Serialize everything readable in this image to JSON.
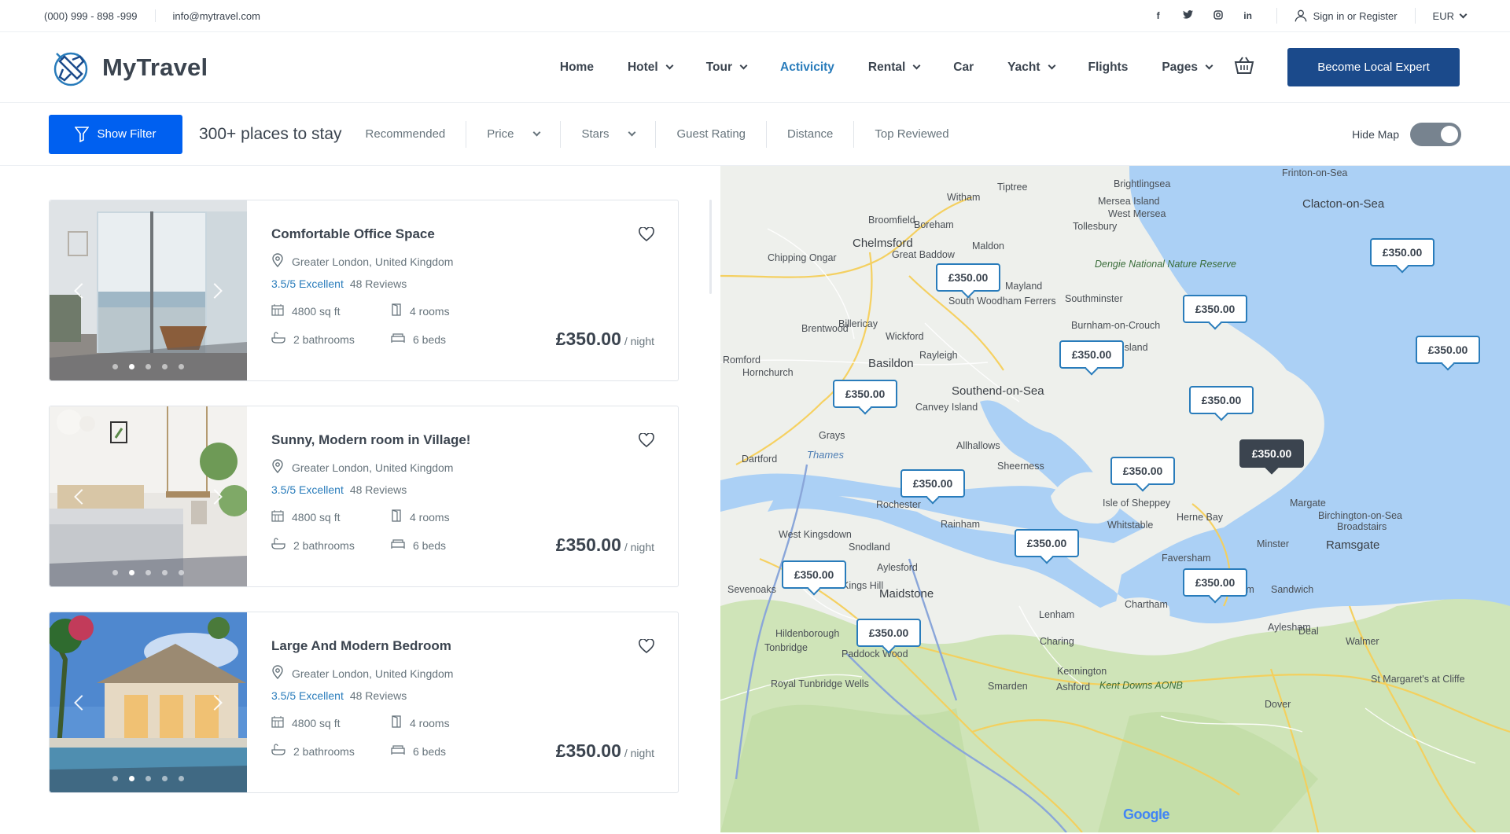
{
  "topbar": {
    "phone": "(000) 999 - 898 -999",
    "email": "info@mytravel.com",
    "social": [
      "f",
      "t",
      "ig",
      "in"
    ],
    "signin": "Sign in or Register",
    "currency": "EUR"
  },
  "brand": {
    "name": "MyTravel"
  },
  "menu": [
    {
      "label": "Home",
      "dropdown": false,
      "active": false
    },
    {
      "label": "Hotel",
      "dropdown": true,
      "active": false
    },
    {
      "label": "Tour",
      "dropdown": true,
      "active": false
    },
    {
      "label": "Activicity",
      "dropdown": false,
      "active": true
    },
    {
      "label": "Rental",
      "dropdown": true,
      "active": false
    },
    {
      "label": "Car",
      "dropdown": false,
      "active": false
    },
    {
      "label": "Yacht",
      "dropdown": true,
      "active": false
    },
    {
      "label": "Flights",
      "dropdown": false,
      "active": false
    },
    {
      "label": "Pages",
      "dropdown": true,
      "active": false
    }
  ],
  "cta": "Become Local Expert",
  "filter": {
    "show_filter": "Show Filter",
    "count_text": "300+ places to stay",
    "sort_options": [
      {
        "label": "Recommended",
        "dropdown": false
      },
      {
        "label": "Price",
        "dropdown": true
      },
      {
        "label": "Stars",
        "dropdown": true
      },
      {
        "label": "Guest Rating",
        "dropdown": false
      },
      {
        "label": "Distance",
        "dropdown": false
      },
      {
        "label": "Top Reviewed",
        "dropdown": false
      }
    ],
    "hide_map": "Hide Map",
    "hide_map_on": true
  },
  "listings": [
    {
      "title": "Comfortable Office Space",
      "location": "Greater London, United Kingdom",
      "score": "3.5/5 Excellent",
      "reviews": "48 Reviews",
      "area": "4800 sq ft",
      "rooms": "4 rooms",
      "bathrooms": "2 bathrooms",
      "beds": "6 beds",
      "price": "£350.00",
      "per": "/ night",
      "photo": "room"
    },
    {
      "title": "Sunny, Modern room in Village!",
      "location": "Greater London, United Kingdom",
      "score": "3.5/5 Excellent",
      "reviews": "48 Reviews",
      "area": "4800 sq ft",
      "rooms": "4 rooms",
      "bathrooms": "2 bathrooms",
      "beds": "6 beds",
      "price": "£350.00",
      "per": "/ night",
      "photo": "bedroom"
    },
    {
      "title": "Large And Modern Bedroom",
      "location": "Greater London, United Kingdom",
      "score": "3.5/5 Excellent",
      "reviews": "48 Reviews",
      "area": "4800 sq ft",
      "rooms": "4 rooms",
      "bathrooms": "2 bathrooms",
      "beds": "6 beds",
      "price": "£350.00",
      "per": "/ night",
      "photo": "villa"
    }
  ],
  "map": {
    "price_pins": [
      "£350.00",
      "£350.00",
      "£350.00",
      "£350.00",
      "£350.00",
      "£350.00",
      "£350.00",
      "£350.00",
      "£350.00",
      "£350.00",
      "£350.00",
      "£350.00",
      "£350.00",
      "£350.00"
    ],
    "places": [
      "Chelmsford",
      "Southend-on-Sea",
      "Basildon",
      "Brentwood",
      "Grays",
      "Dartford",
      "Rochester",
      "Maidstone",
      "Margate",
      "Ramsgate",
      "Clacton-on-Sea",
      "Tonbridge",
      "Isle of Sheppey",
      "Foulness Island",
      "Mersea Island",
      "Whitstable",
      "Faversham",
      "Sevenoaks",
      "Ashford",
      "Canvey Island",
      "Rayleigh",
      "Wickford",
      "Billericay",
      "Tiptree",
      "Witham",
      "Maldon",
      "Sheerness",
      "Herne Bay",
      "Dengie National Nature Reserve",
      "Thames",
      "Romford",
      "Hornchurch",
      "Kings Hill",
      "Aylesford",
      "Snodland",
      "Rainham",
      "Tollesbury",
      "Mayland",
      "Burnham-on-Crouch",
      "Allhallows",
      "Minster",
      "Chartham",
      "Wingham",
      "Aylesham",
      "Deal",
      "Sandwich",
      "Dover",
      "Lenham",
      "Charing",
      "Paddock Wood",
      "Royal Tunbridge Wells",
      "Smarden",
      "Kennington",
      "Kent Downs AONB",
      "Brightlingsea",
      "West Mersea",
      "Frinton-on-Sea",
      "Boreham",
      "Broomfield",
      "Great Baddow",
      "Chipping Ongar",
      "Southminster",
      "South Woodham Ferrers",
      "West Kingsdown",
      "Hildenborough",
      "Birchington-on-Sea",
      "Broadstairs",
      "St Margaret's at Cliffe",
      "Walmer"
    ],
    "attribution": "Google"
  }
}
